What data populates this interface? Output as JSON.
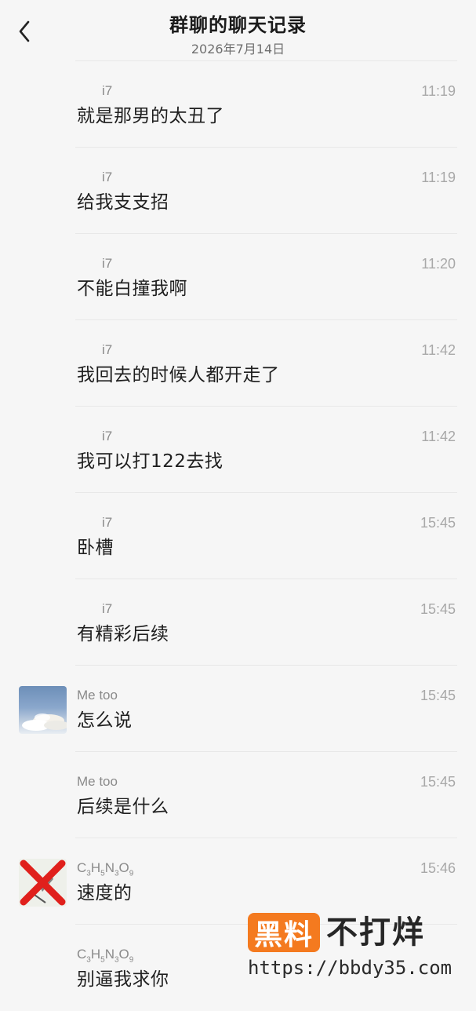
{
  "header": {
    "title": "群聊的聊天记录",
    "date": "2026年7月14日",
    "back_icon": "chevron-left-icon"
  },
  "messages": [
    {
      "sender": "i7",
      "time": "11:19",
      "text": "就是那男的太丑了"
    },
    {
      "sender": "i7",
      "time": "11:19",
      "text": "给我支支招"
    },
    {
      "sender": "i7",
      "time": "11:20",
      "text": "不能白撞我啊"
    },
    {
      "sender": "i7",
      "time": "11:42",
      "text": "我回去的时候人都开走了"
    },
    {
      "sender": "i7",
      "time": "11:42",
      "text": "我可以打122去找"
    },
    {
      "sender": "i7",
      "time": "15:45",
      "text": "卧槽"
    },
    {
      "sender": "i7",
      "time": "15:45",
      "text": "有精彩后续"
    },
    {
      "sender": "Me too",
      "time": "15:45",
      "text": "怎么说",
      "avatar": "sky-clouds-avatar"
    },
    {
      "sender": "Me too",
      "time": "15:45",
      "text": "后续是什么"
    },
    {
      "sender_parts": [
        "C",
        "3",
        "H",
        "5",
        "N",
        "3",
        "O",
        "9"
      ],
      "time": "15:46",
      "text": "速度的",
      "avatar": "red-x-avatar"
    },
    {
      "sender_parts": [
        "C",
        "3",
        "H",
        "5",
        "N",
        "3",
        "O",
        "9"
      ],
      "time": "",
      "text": "别逼我求你"
    }
  ],
  "watermark": {
    "box_text": "黑料",
    "right_text": "不打烊",
    "url": "https://bbdy35.com",
    "accent": "#f47a1f"
  },
  "colors": {
    "background": "#f6f6f6",
    "divider": "#e8e8e8",
    "sender": "#8a8a8a",
    "time": "#a8a8a8"
  }
}
